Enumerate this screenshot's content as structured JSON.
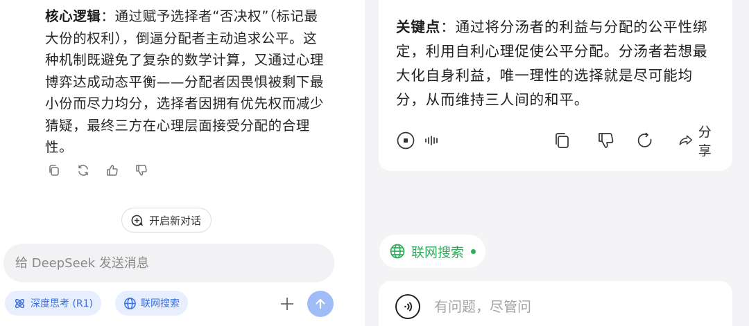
{
  "left": {
    "message": {
      "bold": "核心逻辑",
      "text": "：通过赋予选择者“否决权”（标记最大份的权利），倒逼分配者主动追求公平。这种机制既避免了复杂的数学计算，又通过心理博弈达成动态平衡——分配者因畏惧被剩下最小份而尽力均分，选择者因拥有优先权而减少猜疑，最终三方在心理层面接受分配的合理性。"
    },
    "new_chat_label": "开启新对话",
    "input_placeholder": "给 DeepSeek 发送消息",
    "deep_think_label": "深度思考 (R1)",
    "web_search_label": "联网搜索"
  },
  "right": {
    "message": {
      "bold": "关键点",
      "text": "：通过将分汤者的利益与分配的公平性绑定，利用自利心理促使公平分配。分汤者若想最大化自身利益，唯一理性的选择就是尽可能均分，从而维持三人间的和平。"
    },
    "share_label": "分享",
    "web_search_label": "联网搜索",
    "input_placeholder": "有问题，尽管问"
  },
  "colors": {
    "deepseek_accent": "#3b6fe0",
    "send_button": "#9fbcf7",
    "web_search_green": "#2eae5b"
  },
  "icons": [
    "copy-icon",
    "regenerate-icon",
    "thumbs-up-icon",
    "thumbs-down-icon",
    "new-chat-icon",
    "atom-icon",
    "globe-icon",
    "plus-icon",
    "arrow-up-icon",
    "play-icon",
    "waveform-icon",
    "share-icon",
    "voice-icon"
  ]
}
